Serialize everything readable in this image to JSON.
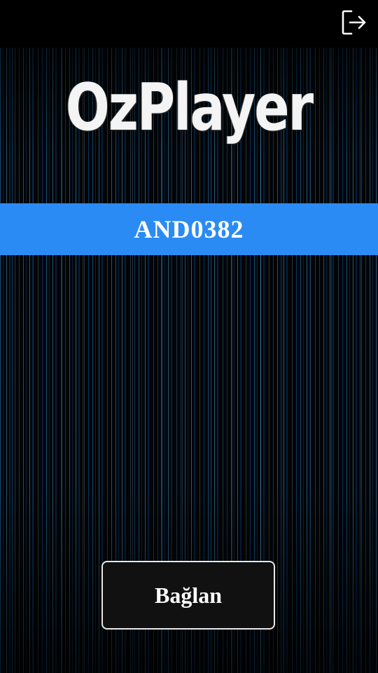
{
  "header": {
    "exit_icon": "exit-icon"
  },
  "brand": {
    "logo_text": "OzPlayer"
  },
  "device": {
    "code": "AND0382"
  },
  "actions": {
    "connect_label": "Bağlan"
  },
  "colors": {
    "accent": "#2a8bf5",
    "background": "#000000",
    "button_bg": "#111111",
    "text": "#ffffff"
  }
}
